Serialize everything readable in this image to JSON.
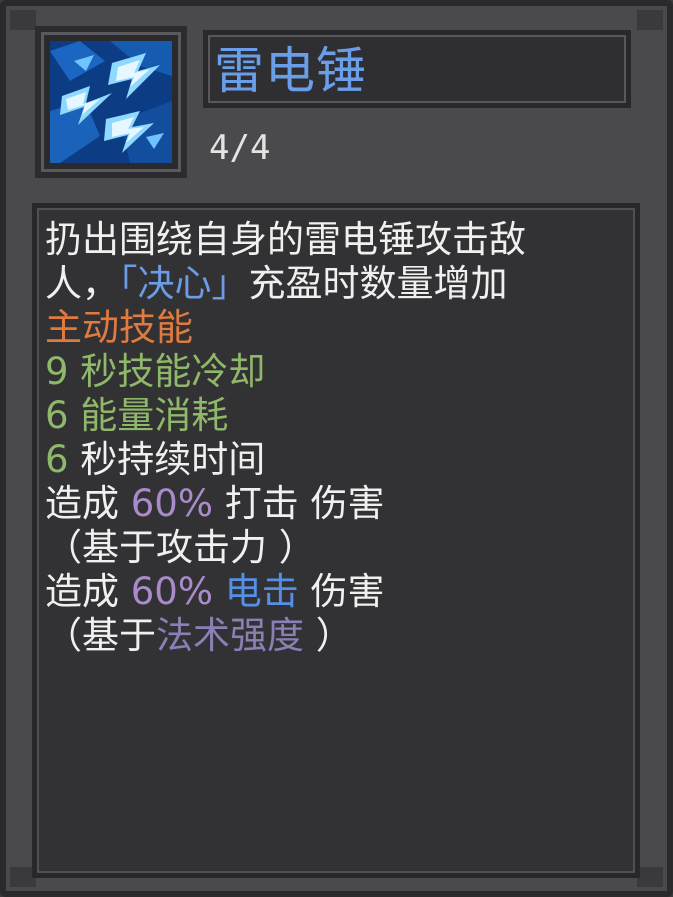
{
  "skill": {
    "name": "雷电锤",
    "charges": "4/4",
    "icon": "lightning-hammer-icon"
  },
  "description": {
    "line1": "扔出围绕自身的雷电锤攻击敌",
    "line2_a": "人，",
    "line2_b": "「决心」",
    "line2_c": "充盈时数量增加",
    "skill_type": "主动技能",
    "cooldown": "9 秒技能冷却",
    "energy_cost": "6 能量消耗",
    "duration_num": "6",
    "duration_text": " 秒持续时间",
    "damage1_prefix": "造成 ",
    "damage1_pct": "60%",
    "damage1_type": " 打击 ",
    "damage1_suffix": "伤害",
    "damage1_basis": "（基于攻击力 ）",
    "damage2_prefix": "造成 ",
    "damage2_pct": "60%",
    "damage2_type": " 电击 ",
    "damage2_suffix": "伤害",
    "damage2_basis_a": "（基于",
    "damage2_basis_b": "法术强度",
    "damage2_basis_c": " ）"
  },
  "colors": {
    "title": "#6a9ee8",
    "keyword": "#6c9ce6",
    "skill_type": "#e07a3e",
    "stat": "#8fb86a",
    "percent": "#a98bc9",
    "element": "#5590e6",
    "stat_source": "#8c7fb6"
  }
}
